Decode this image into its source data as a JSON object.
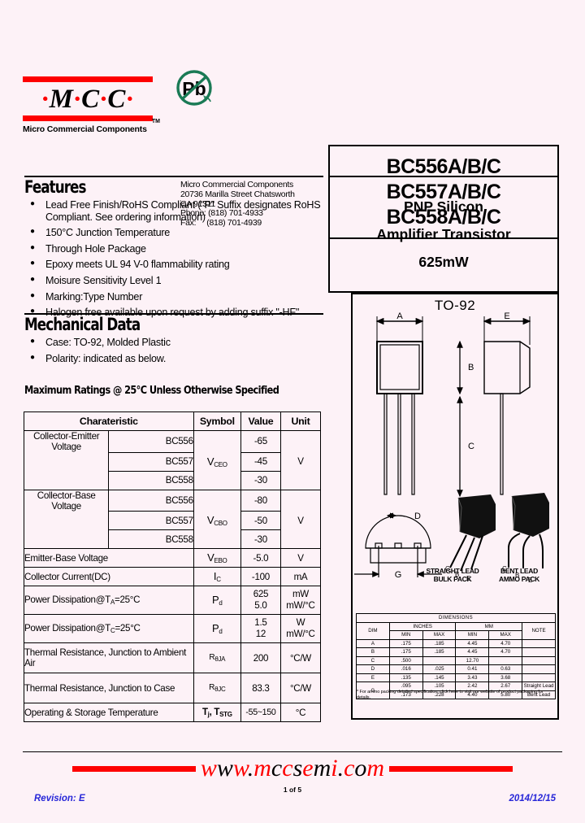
{
  "header": {
    "logo_text": "M·C·C",
    "logo_tm": "TM",
    "logo_subtitle": "Micro Commercial Components",
    "pb_icon_label": "Pb",
    "company_lines": [
      "Micro Commercial Components",
      "20736 Marilla Street Chatsworth",
      "CA 91311",
      "Phone: (818) 701-4933",
      "Fax:     (818) 701-4939"
    ],
    "part_numbers": [
      "BC556A/B/C",
      "BC557A/B/C",
      "BC558A/B/C"
    ]
  },
  "description_box": {
    "lines": [
      "PNP Silicon",
      "Amplifier Transistor",
      "625mW"
    ]
  },
  "features": {
    "title": "Features",
    "items": [
      "Lead Free Finish/RoHS Compliant (\"P\" Suffix designates RoHS Compliant.  See ordering information)",
      "150°C Junction Temperature",
      "Through Hole Package",
      "Epoxy meets UL 94 V-0 flammability rating",
      "Moisure Sensitivity Level 1",
      "Marking:Type Number"
    ],
    "footnote": "Halogen free available upon request by adding suffix \"-HF\""
  },
  "mechanical": {
    "title": "Mechanical Data",
    "items": [
      "Case: TO-92, Molded Plastic",
      "Polarity: indicated as below."
    ]
  },
  "ratings": {
    "title": "Maximum Ratings @ 25°C Unless Otherwise Specified",
    "columns": [
      "Charateristic",
      "Symbol",
      "Value",
      "Unit"
    ],
    "rows": [
      {
        "characteristic": "Collector-Emitter Voltage",
        "parts": [
          "BC556",
          "BC557",
          "BC558"
        ],
        "symbol": "VCEO",
        "values": [
          "-65",
          "-45",
          "-30"
        ],
        "unit": "V"
      },
      {
        "characteristic": "Collector-Base Voltage",
        "parts": [
          "BC556",
          "BC557",
          "BC558"
        ],
        "symbol": "VCBO",
        "values": [
          "-80",
          "-50",
          "-30"
        ],
        "unit": "V"
      },
      {
        "characteristic": "Emitter-Base Voltage",
        "symbol": "VEBO",
        "values": [
          "-5.0"
        ],
        "unit": "V"
      },
      {
        "characteristic": "Collector Current(DC)",
        "symbol": "IC",
        "values": [
          "-100"
        ],
        "unit": "mA"
      },
      {
        "characteristic": "Power Dissipation@TA=25°C",
        "symbol": "Pd",
        "values": [
          "625",
          "5.0"
        ],
        "unit": [
          "mW",
          "mW/°C"
        ]
      },
      {
        "characteristic": "Power Dissipation@TC=25°C",
        "symbol": "Pd",
        "values": [
          "1.5",
          "12"
        ],
        "unit": [
          "W",
          "mW/°C"
        ]
      },
      {
        "characteristic": "Thermal Resistance, Junction to Ambient Air",
        "symbol": "RθJA",
        "values": [
          "200"
        ],
        "unit": "°C/W"
      },
      {
        "characteristic": "Thermal Resistance, Junction to Case",
        "symbol": "RθJC",
        "values": [
          "83.3"
        ],
        "unit": "°C/W"
      },
      {
        "characteristic": "Operating & Storage Temperature",
        "symbol": "Tj, TSTG",
        "values": [
          "-55~150"
        ],
        "unit": "°C"
      }
    ],
    "cells": {
      "r1_c": "Collector-Emitter Voltage",
      "r1_p1": "BC556",
      "r1_p2": "BC557",
      "r1_p3": "BC558",
      "r1_v1": "-65",
      "r1_v2": "-45",
      "r1_v3": "-30",
      "r1_u": "V",
      "r2_c": "Collector-Base Voltage",
      "r2_p1": "BC556",
      "r2_p2": "BC557",
      "r2_p3": "BC558",
      "r2_v1": "-80",
      "r2_v2": "-50",
      "r2_v3": "-30",
      "r2_u": "V",
      "r3_c": "Emitter-Base Voltage",
      "r3_v": "-5.0",
      "r3_u": "V",
      "r4_c": "Collector Current(DC)",
      "r4_v": "-100",
      "r4_u": "mA",
      "r5_v1": "625",
      "r5_v2": "5.0",
      "r5_u1": "mW",
      "r5_u2": "mW/°C",
      "r6_v1": "1.5",
      "r6_v2": "12",
      "r6_u1": "W",
      "r6_u2": "mW/°C",
      "r7_c": "Thermal Resistance, Junction to Ambient Air",
      "r7_v": "200",
      "r7_u": "°C/W",
      "r8_c": "Thermal Resistance, Junction to Case",
      "r8_v": "83.3",
      "r8_u": "°C/W",
      "r9_c": "Operating & Storage Temperature",
      "r9_v": "-55~150",
      "r9_u": "°C"
    }
  },
  "package": {
    "title": "TO-92",
    "dim_labels": {
      "A": "A",
      "B": "B",
      "C": "C",
      "D": "D",
      "E": "E",
      "G": "G"
    },
    "pin_labels": {
      "c": "C",
      "b": "B",
      "e": "E"
    },
    "lead_styles": [
      {
        "line1": "STRAIGHT LEAD",
        "line2": "BULK PACK"
      },
      {
        "line1": "BENT LEAD",
        "line2": "AMMO PACK"
      }
    ],
    "dimensions_table": {
      "title": "DIMENSIONS",
      "group_headers": [
        "INCHES",
        "MM"
      ],
      "columns": [
        "DIM",
        "MIN",
        "MAX",
        "MIN",
        "MAX",
        "NOTE"
      ],
      "rows": [
        {
          "dim": "A",
          "in_min": ".175",
          "in_max": ".185",
          "mm_min": "4.45",
          "mm_max": "4.70",
          "note": ""
        },
        {
          "dim": "B",
          "in_min": ".175",
          "in_max": ".185",
          "mm_min": "4.45",
          "mm_max": "4.70",
          "note": ""
        },
        {
          "dim": "C",
          "in_min": ".500",
          "in_max": "",
          "mm_min": "12.70",
          "mm_max": "",
          "note": ""
        },
        {
          "dim": "D",
          "in_min": ".016",
          "in_max": ".025",
          "mm_min": "0.41",
          "mm_max": "0.63",
          "note": ""
        },
        {
          "dim": "E",
          "in_min": ".135",
          "in_max": ".145",
          "mm_min": "3.43",
          "mm_max": "3.68",
          "note": ""
        },
        {
          "dim": "G",
          "in_min": ".095",
          "in_max": ".105",
          "mm_min": "2.42",
          "mm_max": "2.67",
          "note": "Straight Lead"
        },
        {
          "dim": "",
          "in_min": ".173",
          "in_max": ".228",
          "mm_min": "4.40",
          "mm_max": "5.80",
          "note": "Bent Lead"
        }
      ]
    },
    "note": "* For ammo packing detailed specification, click here to visit our website of product packaging for details."
  },
  "footer": {
    "url_parts": [
      {
        "t": "w",
        "c": "red"
      },
      {
        "t": "w",
        "c": "black"
      },
      {
        "t": "w",
        "c": "red"
      },
      {
        "t": ".",
        "c": "black"
      },
      {
        "t": "m",
        "c": "red"
      },
      {
        "t": "c",
        "c": "black"
      },
      {
        "t": "c",
        "c": "red"
      },
      {
        "t": "s",
        "c": "black"
      },
      {
        "t": "e",
        "c": "red"
      },
      {
        "t": "m",
        "c": "black"
      },
      {
        "t": "i",
        "c": "red"
      },
      {
        "t": ".",
        "c": "black"
      },
      {
        "t": "c",
        "c": "red"
      },
      {
        "t": "o",
        "c": "black"
      },
      {
        "t": "m",
        "c": "red"
      }
    ],
    "url_text": "www.mccsemi.com",
    "page": "1 of 5",
    "revision": "Revision: E",
    "date": "2014/12/15"
  },
  "colors": {
    "background": "#fdf2f7",
    "brand_red": "#fe0000",
    "pb_green": "#1a7a55",
    "footer_blue": "#2727d8"
  }
}
